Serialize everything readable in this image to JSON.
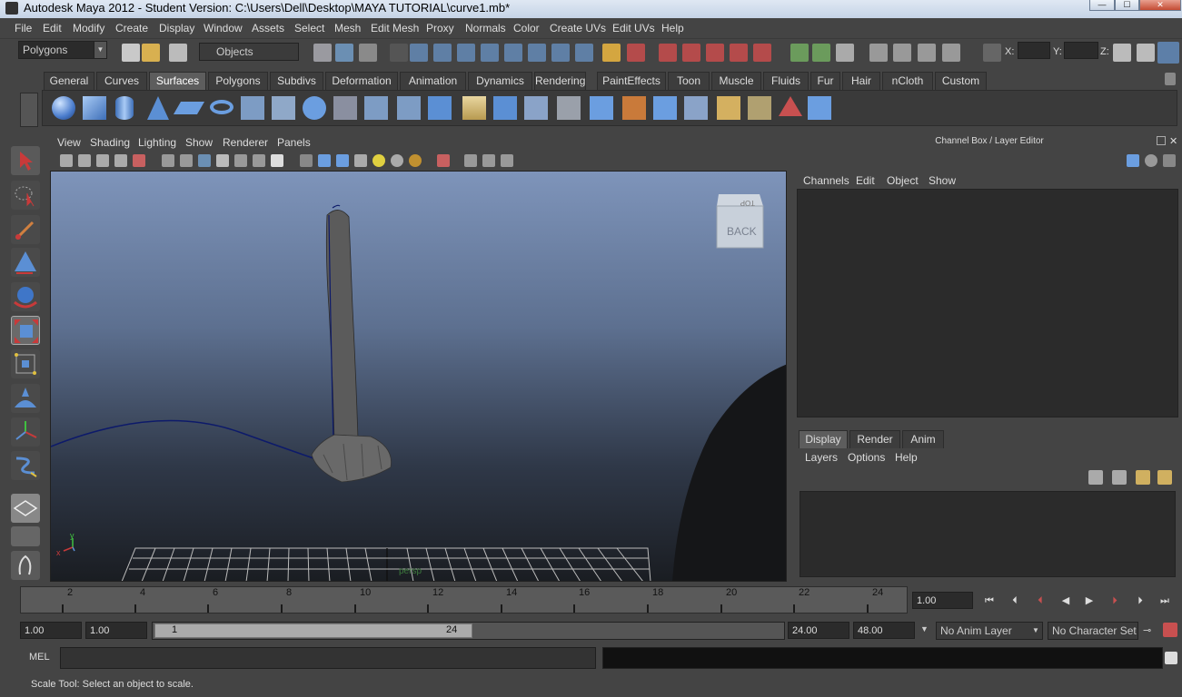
{
  "window": {
    "title": "Autodesk Maya 2012 - Student Version: C:\\Users\\Dell\\Desktop\\MAYA TUTORIAL\\curve1.mb*"
  },
  "menubar": [
    "File",
    "Edit",
    "Modify",
    "Create",
    "Display",
    "Window",
    "Assets",
    "Select",
    "Mesh",
    "Edit Mesh",
    "Proxy",
    "Normals",
    "Color",
    "Create UVs",
    "Edit UVs",
    "Help"
  ],
  "statusline": {
    "menuset": "Polygons",
    "selection_mask": "Objects",
    "x_label": "X:",
    "y_label": "Y:",
    "z_label": "Z:"
  },
  "shelf": {
    "tabs": [
      "General",
      "Curves",
      "Surfaces",
      "Polygons",
      "Subdivs",
      "Deformation",
      "Animation",
      "Dynamics",
      "Rendering",
      "PaintEffects",
      "Toon",
      "Muscle",
      "Fluids",
      "Fur",
      "Hair",
      "nCloth",
      "Custom"
    ],
    "active_tab": "Surfaces"
  },
  "viewport": {
    "menus": [
      "View",
      "Shading",
      "Lighting",
      "Show",
      "Renderer",
      "Panels"
    ],
    "viewcube_back": "BACK",
    "viewcube_top": "TOP",
    "camera_label": "persp",
    "axis_x": "x",
    "axis_y": "y"
  },
  "channelbox": {
    "title": "Channel Box / Layer Editor",
    "menus": [
      "Channels",
      "Edit",
      "Object",
      "Show"
    ]
  },
  "layereditor": {
    "tabs": [
      "Display",
      "Render",
      "Anim"
    ],
    "active_tab": "Display",
    "menus": [
      "Layers",
      "Options",
      "Help"
    ]
  },
  "timeline": {
    "ticks": [
      "2",
      "4",
      "6",
      "8",
      "10",
      "12",
      "14",
      "16",
      "18",
      "20",
      "22",
      "24"
    ],
    "current_time": "1.00"
  },
  "range": {
    "start": "1.00",
    "anim_start": "1.00",
    "range_start": "1",
    "range_end": "24",
    "anim_end": "24.00",
    "end": "48.00",
    "anim_layer": "No Anim Layer",
    "character_set": "No Character Set"
  },
  "commandline": {
    "label": "MEL"
  },
  "helpline": {
    "text": "Scale Tool: Select an object to scale."
  }
}
